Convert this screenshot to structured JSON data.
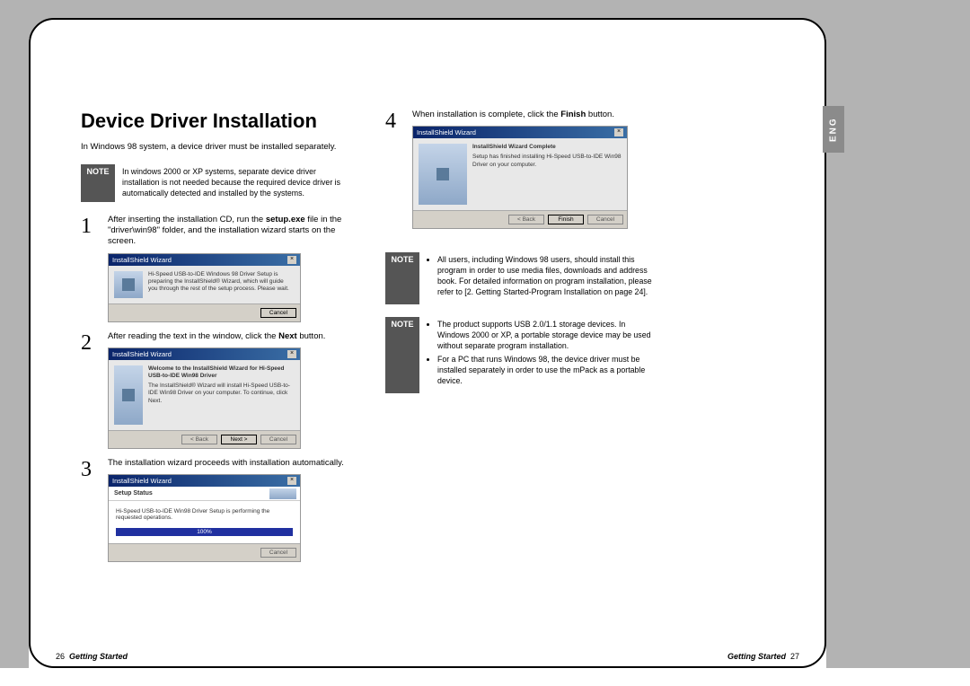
{
  "lang_tab": "ENG",
  "title": "Device Driver Installation",
  "intro": "In Windows 98 system, a device driver must be installed separately.",
  "topnote": {
    "label": "NOTE",
    "text": "In windows 2000 or XP systems, separate device driver installation is not needed because the required device driver is automatically detected and installed by the systems."
  },
  "steps": {
    "s1": {
      "num": "1",
      "text_a": "After inserting the installation CD, run the ",
      "text_b": "setup.exe",
      "text_c": " file in the \"driver\\win98\" folder, and the installation wizard starts on the screen.",
      "wiz_title": "InstallShield Wizard",
      "wiz_body": "Hi-Speed USB-to-IDE Windows 98 Driver Setup is preparing the InstallShield® Wizard, which will guide you through the rest of the setup process. Please wait.",
      "btn_cancel": "Cancel"
    },
    "s2": {
      "num": "2",
      "text_a": "After reading the text in the window, click the ",
      "text_b": "Next",
      "text_c": " button.",
      "wiz_title": "InstallShield Wizard",
      "wiz_head": "Welcome to the InstallShield Wizard for Hi-Speed USB-to-IDE Win98 Driver",
      "wiz_body": "The InstallShield® Wizard will install Hi-Speed USB-to-IDE Win98 Driver on your computer. To continue, click Next.",
      "btn_back": "< Back",
      "btn_next": "Next >",
      "btn_cancel": "Cancel"
    },
    "s3": {
      "num": "3",
      "text": "The installation wizard proceeds with installation automatically.",
      "wiz_title": "InstallShield Wizard",
      "status_head": "Setup Status",
      "status_body": "Hi-Speed USB-to-IDE Win98 Driver Setup is performing the requested operations.",
      "progress": "100%",
      "btn_cancel": "Cancel"
    },
    "s4": {
      "num": "4",
      "text_a": "When installation is complete, click the ",
      "text_b": "Finish",
      "text_c": " button.",
      "wiz_title": "InstallShield Wizard",
      "wiz_head": "InstallShield Wizard Complete",
      "wiz_body": "Setup has finished installing Hi-Speed USB-to-IDE Win98 Driver on your computer.",
      "btn_back": "< Back",
      "btn_finish": "Finish",
      "btn_cancel": "Cancel"
    }
  },
  "note2": {
    "label": "NOTE",
    "items": [
      "All users, including Windows 98 users, should install this program in order to use media files, downloads and address book. For detailed information on program installation, please refer to [2. Getting Started-Program Installation on page 24]."
    ]
  },
  "note3": {
    "label": "NOTE",
    "items": [
      "The product supports USB 2.0/1.1 storage devices. In Windows 2000 or XP, a portable storage device may be used without separate program installation.",
      "For a PC that runs Windows 98, the device driver must be installed separately in order to use the mPack as a portable device."
    ]
  },
  "footer": {
    "left_page": "26",
    "section": "Getting Started",
    "right_page": "27"
  }
}
